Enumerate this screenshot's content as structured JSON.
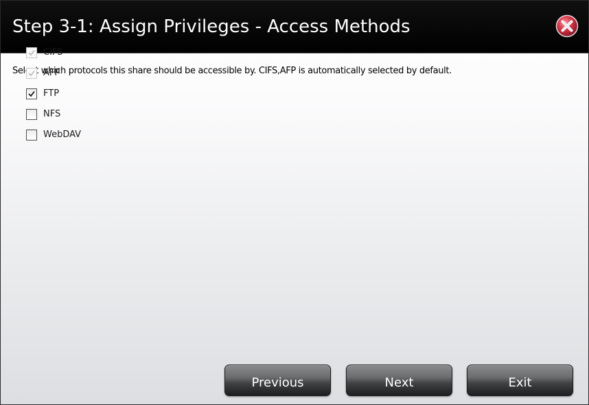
{
  "dialog": {
    "title": "Step 3-1: Assign Privileges - Access Methods",
    "description": "Select which protocols this share should be accessible by. CIFS,AFP is automatically selected by default.",
    "close_icon": "close-x-icon"
  },
  "protocols": [
    {
      "label": "CIFS",
      "checked": true,
      "disabled": true
    },
    {
      "label": "AFP",
      "checked": true,
      "disabled": true
    },
    {
      "label": "FTP",
      "checked": true,
      "disabled": false
    },
    {
      "label": "NFS",
      "checked": false,
      "disabled": false
    },
    {
      "label": "WebDAV",
      "checked": false,
      "disabled": false
    }
  ],
  "buttons": {
    "previous_label": "Previous",
    "next_label": "Next",
    "exit_label": "Exit"
  },
  "colors": {
    "titlebar_bg": "#000000",
    "title_text": "#ffffff",
    "close_button_red": "#cc2233",
    "button_gray": "#555658"
  }
}
